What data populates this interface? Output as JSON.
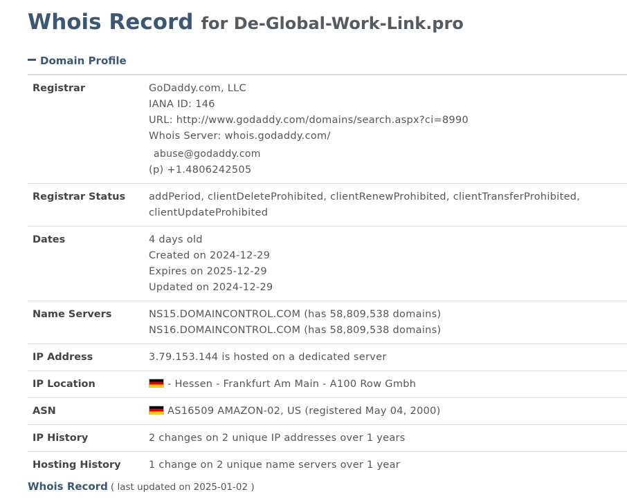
{
  "header": {
    "title": "Whois Record",
    "subtitle": "for De-Global-Work-Link.pro"
  },
  "section": {
    "label": "Domain Profile",
    "icon": "minus-icon"
  },
  "rows": {
    "registrar": {
      "label": "Registrar",
      "name": "GoDaddy.com, LLC",
      "iana": "IANA ID: 146",
      "url": "URL: http://www.godaddy.com/domains/search.aspx?ci=8990",
      "whois_server": "Whois Server: whois.godaddy.com/",
      "email": "abuse@godaddy.com",
      "phone_prefix": "(p)",
      "phone": "+1.4806242505"
    },
    "status": {
      "label": "Registrar Status",
      "line1": "addPeriod, clientDeleteProhibited, clientRenewProhibited, clientTransferProhibited,",
      "line2": "clientUpdateProhibited"
    },
    "dates": {
      "label": "Dates",
      "age": "4 days old",
      "created": "Created on 2024-12-29",
      "expires": "Expires on 2025-12-29",
      "updated": "Updated on 2024-12-29"
    },
    "name_servers": {
      "label": "Name Servers",
      "ns1": "NS15.DOMAINCONTROL.COM (has 58,809,538 domains)",
      "ns2": "NS16.DOMAINCONTROL.COM (has 58,809,538 domains)"
    },
    "ip_address": {
      "label": "IP Address",
      "value": "3.79.153.144 is hosted on a dedicated server"
    },
    "ip_location": {
      "label": "IP Location",
      "flag": "germany-flag-icon",
      "value": "- Hessen - Frankfurt Am Main - A100 Row Gmbh"
    },
    "asn": {
      "label": "ASN",
      "flag": "germany-flag-icon",
      "value": "AS16509 AMAZON-02, US (registered May 04, 2000)"
    },
    "ip_history": {
      "label": "IP History",
      "value": "2 changes on 2 unique IP addresses over 1 years"
    },
    "hosting_history": {
      "label": "Hosting History",
      "value": "1 change on 2 unique name servers over 1 year"
    }
  },
  "footer": {
    "title": "Whois Record",
    "open_paren": "(",
    "updated_text": "last updated on 2025-01-02",
    "close_paren": ")"
  },
  "colors": {
    "heading": "#3c5773",
    "text": "#555555",
    "border": "#dcdcdc"
  }
}
